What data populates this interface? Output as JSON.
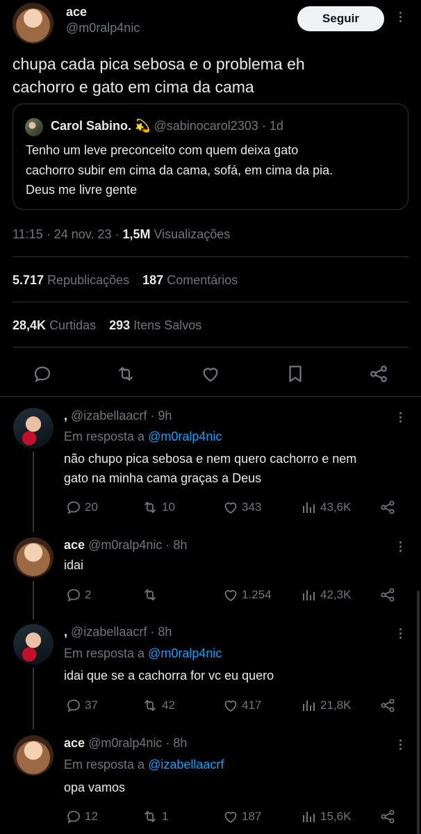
{
  "tweet": {
    "name": "ace",
    "handle": "@m0ralp4nic",
    "follow_label": "Seguir",
    "text_line1": "chupa cada pica sebosa e o problema eh",
    "text_line2": "cachorro e gato em cima da cama",
    "quote": {
      "name": "Carol Sabino.",
      "emoji": "💫",
      "handle": "@sabinocarol2303",
      "sep": "·",
      "time": "1d",
      "line1": "Tenho um leve preconceito com quem deixa gato",
      "line2": "cachorro subir em cima da cama, sofá, em cima da pia.",
      "line3": "Deus me livre gente"
    },
    "meta_time": "11:15",
    "meta_date": "24 nov. 23",
    "meta_views_count": "1,5M",
    "meta_views_label": "Visualizações",
    "reposts_count": "5.717",
    "reposts_label": "Republicações",
    "comments_count": "187",
    "comments_label": "Comentários",
    "likes_count": "28,4K",
    "likes_label": "Curtidas",
    "saved_count": "293",
    "saved_label": "Itens Salvos"
  },
  "replies": [
    {
      "name": ",",
      "handle": "@izabellaacrf",
      "time": "9h",
      "reply_prefix": "Em resposta a",
      "reply_to": "@m0ralp4nic",
      "line1": "não chupo pica sebosa e nem quero cachorro e nem",
      "line2": "gato na minha cama graças a Deus",
      "comments": "20",
      "reposts": "10",
      "likes": "343",
      "views": "43,6K"
    },
    {
      "name": "ace",
      "handle": "@m0ralp4nic",
      "time": "8h",
      "line1": "idai",
      "comments": "2",
      "reposts": "",
      "likes": "1.254",
      "views": "42,3K"
    },
    {
      "name": ",",
      "handle": "@izabellaacrf",
      "time": "8h",
      "reply_prefix": "Em resposta a",
      "reply_to": "@m0ralp4nic",
      "line1": "idai que se a cachorra for vc eu quero",
      "comments": "37",
      "reposts": "42",
      "likes": "417",
      "views": "21,8K"
    },
    {
      "name": "ace",
      "handle": "@m0ralp4nic",
      "time": "8h",
      "reply_prefix": "Em resposta a",
      "reply_to": "@izabellaacrf",
      "line1": "opa vamos",
      "comments": "12",
      "reposts": "1",
      "likes": "187",
      "views": "15,6K"
    }
  ],
  "icons": {
    "comment": "comment-icon",
    "repost": "repost-icon",
    "like": "heart-icon",
    "bookmark": "bookmark-icon",
    "share": "share-icon",
    "views": "views-icon",
    "more": "more-icon"
  },
  "colors": {
    "background": "#000000",
    "text": "#e7e9ea",
    "secondary": "#71767b",
    "link": "#1d9bf0",
    "divider": "#2f3336"
  }
}
